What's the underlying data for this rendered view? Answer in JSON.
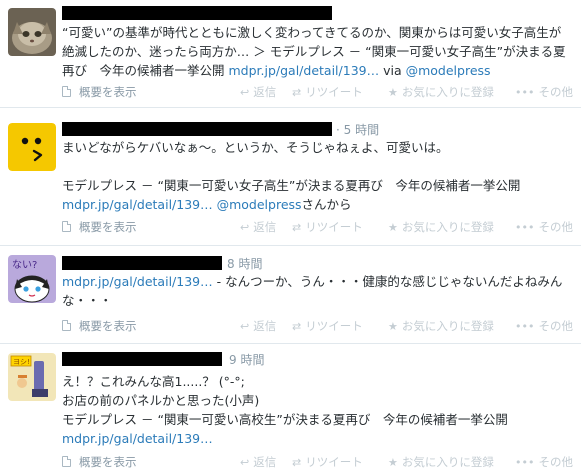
{
  "tweets": [
    {
      "time": "",
      "text_prefix": "“可愛い”の基準が時代とともに激しく変わってきてるのか、関東からは可愛い女子高生が絶滅したのか、迷ったら両方か… ＞ モデルプレス － “関東一可愛い女子高生”が決まる夏再び　今年の候補者一挙公開 ",
      "link": "mdpr.jp/gal/detail/139…",
      "via_label": " via ",
      "mention": "@modelpress",
      "suffix": ""
    },
    {
      "time": "· 5 時間",
      "text_prefix": "まいどながらケバいなぁ〜。というか、そうじゃねぇよ、可愛いは。\n\nモデルプレス － “関東一可愛い女子高生”が決まる夏再び　今年の候補者一挙公開\n",
      "link": "mdpr.jp/gal/detail/139…",
      "via_label": " ",
      "mention": "@modelpress",
      "suffix": "さんから"
    },
    {
      "time": "8 時間",
      "text_prefix": "",
      "link": "mdpr.jp/gal/detail/139…",
      "via_label": "",
      "mention": "",
      "suffix": " - なんつーか、うん・・・健康的な感じじゃないんだよねみんな・・・"
    },
    {
      "time": "9 時間",
      "text_prefix": "え！？これみんな高1.....？ (°-°;\nお店の前のパネルかと思った(小声)\nモデルプレス － “関東一可愛い高校生”が決まる夏再び　今年の候補者一挙公開\n",
      "link": "mdpr.jp/gal/detail/139…",
      "via_label": "",
      "mention": "",
      "suffix": ""
    }
  ],
  "actions": {
    "summary": "概要を表示",
    "reply": "返信",
    "retweet": "リツイート",
    "favorite": "お気に入りに登録",
    "more": "その他"
  },
  "icons": {
    "summary": "summary-document-icon",
    "reply": "reply-arrow-icon",
    "retweet": "retweet-icon",
    "favorite": "star-icon",
    "more": "more-dots-icon"
  },
  "colors": {
    "link": "#2b7bb9",
    "meta": "#8899a6",
    "text": "#292f33",
    "divider": "#e1e8ed"
  }
}
